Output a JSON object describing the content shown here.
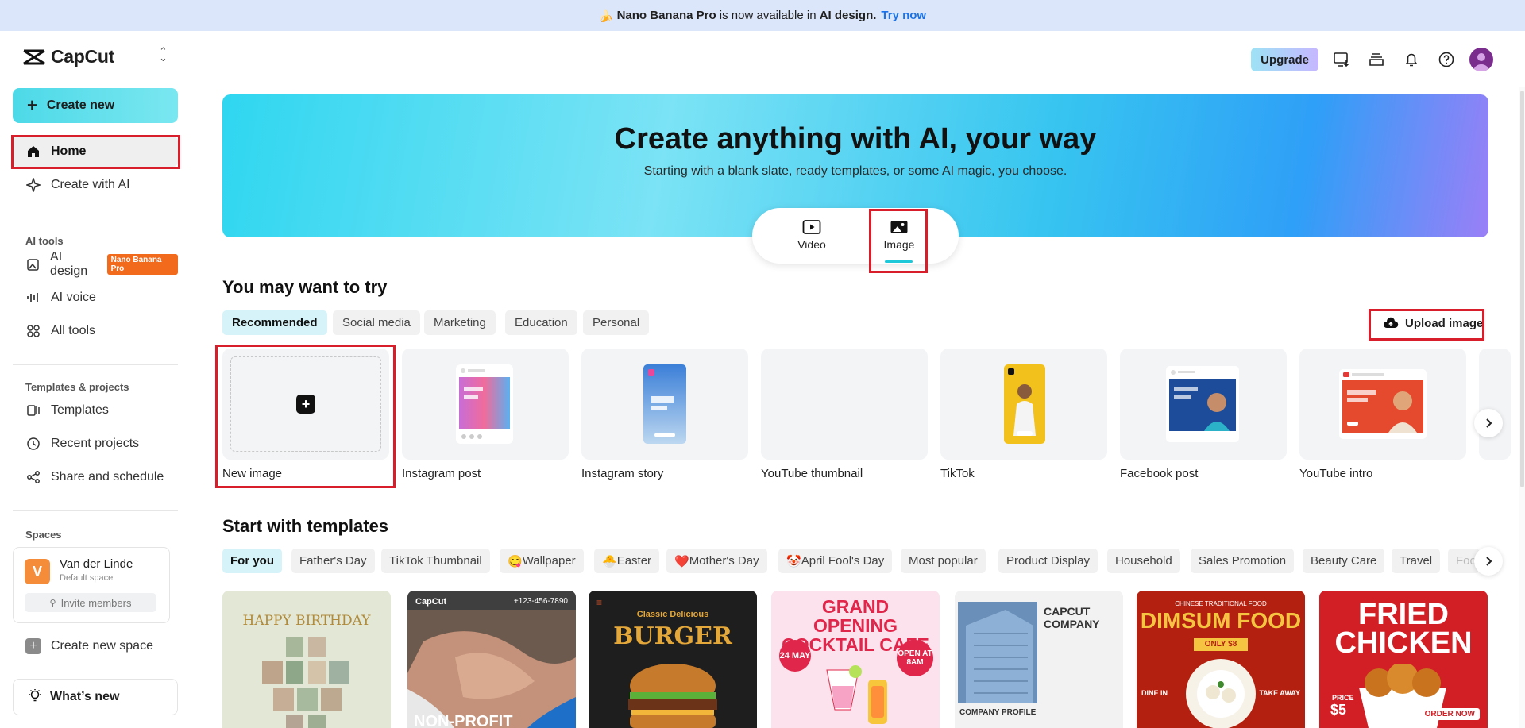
{
  "banner": {
    "product": "Nano Banana Pro",
    "middle": "is now available in",
    "feature": "AI design.",
    "cta": "Try now"
  },
  "brand": {
    "name": "CapCut"
  },
  "sidebar": {
    "create_new": "Create new",
    "home": "Home",
    "create_with_ai": "Create with AI",
    "ai_tools_title": "AI tools",
    "ai_design": "AI design",
    "ai_design_badge": "Nano Banana Pro",
    "ai_voice": "AI voice",
    "all_tools": "All tools",
    "templates_projects_title": "Templates & projects",
    "templates": "Templates",
    "recent_projects": "Recent projects",
    "share_schedule": "Share and schedule",
    "spaces_title": "Spaces",
    "space": {
      "initial": "V",
      "name": "Van der Linde",
      "sub": "Default space",
      "invite": "Invite members"
    },
    "create_new_space": "Create new space",
    "whats_new": "What’s new"
  },
  "topbar": {
    "upgrade": "Upgrade"
  },
  "hero": {
    "title": "Create anything with AI, your way",
    "subtitle": "Starting with a blank slate, ready templates, or some AI magic, you choose.",
    "modes": [
      "Video",
      "Image"
    ],
    "selected_mode": "Image"
  },
  "try_section": {
    "title": "You may want to try",
    "filters": [
      "Recommended",
      "Social media",
      "Marketing",
      "Education",
      "Personal"
    ],
    "active_filter": "Recommended",
    "upload_label": "Upload image",
    "cards": [
      "New image",
      "Instagram post",
      "Instagram story",
      "YouTube thumbnail",
      "TikTok",
      "Facebook post",
      "YouTube intro"
    ]
  },
  "templates_section": {
    "title": "Start with templates",
    "filters": [
      "For you",
      "Father's Day",
      "TikTok Thumbnail",
      "Wallpaper",
      "Easter",
      "Mother's Day",
      "April Fool's Day",
      "Most popular",
      "Product Display",
      "Household",
      "Sales Promotion",
      "Beauty Care",
      "Travel",
      "Foo"
    ],
    "active_filter": "For you",
    "cards": [
      {
        "text": "HAPPY BIRTHDAY",
        "bg": "#e3e8d6"
      },
      {
        "text": "NON-PROFIT",
        "bg": "#3a3a3a",
        "top_left": "CapCut",
        "top_right": "+123-456-7890"
      },
      {
        "text": "BURGER",
        "pre": "Classic Delicious",
        "bg": "#1e1e1e"
      },
      {
        "text": "GRAND OPENING COCKTAIL CAFE",
        "tag1": "24 MAY",
        "tag2": "OPEN AT 8AM",
        "bg": "#fbe2ec"
      },
      {
        "text": "CAPCUT COMPANY",
        "foot": "COMPANY PROFILE",
        "bg": "#f0f0f0"
      },
      {
        "text": "DIMSUM FOOD",
        "pre": "CHINESE TRADITIONAL FOOD",
        "price": "ONLY $8",
        "dine": "DINE IN",
        "take": "TAKE AWAY",
        "bg": "#b3200f"
      },
      {
        "text": "FRIED CHICKEN",
        "tag": "ORDER NOW",
        "price_label": "PRICE",
        "price": "$5",
        "bg": "#d21f25"
      }
    ]
  },
  "colors": {
    "accent": "#1fc8d8",
    "highlight": "#d81e2a",
    "link": "#1a73e8"
  }
}
